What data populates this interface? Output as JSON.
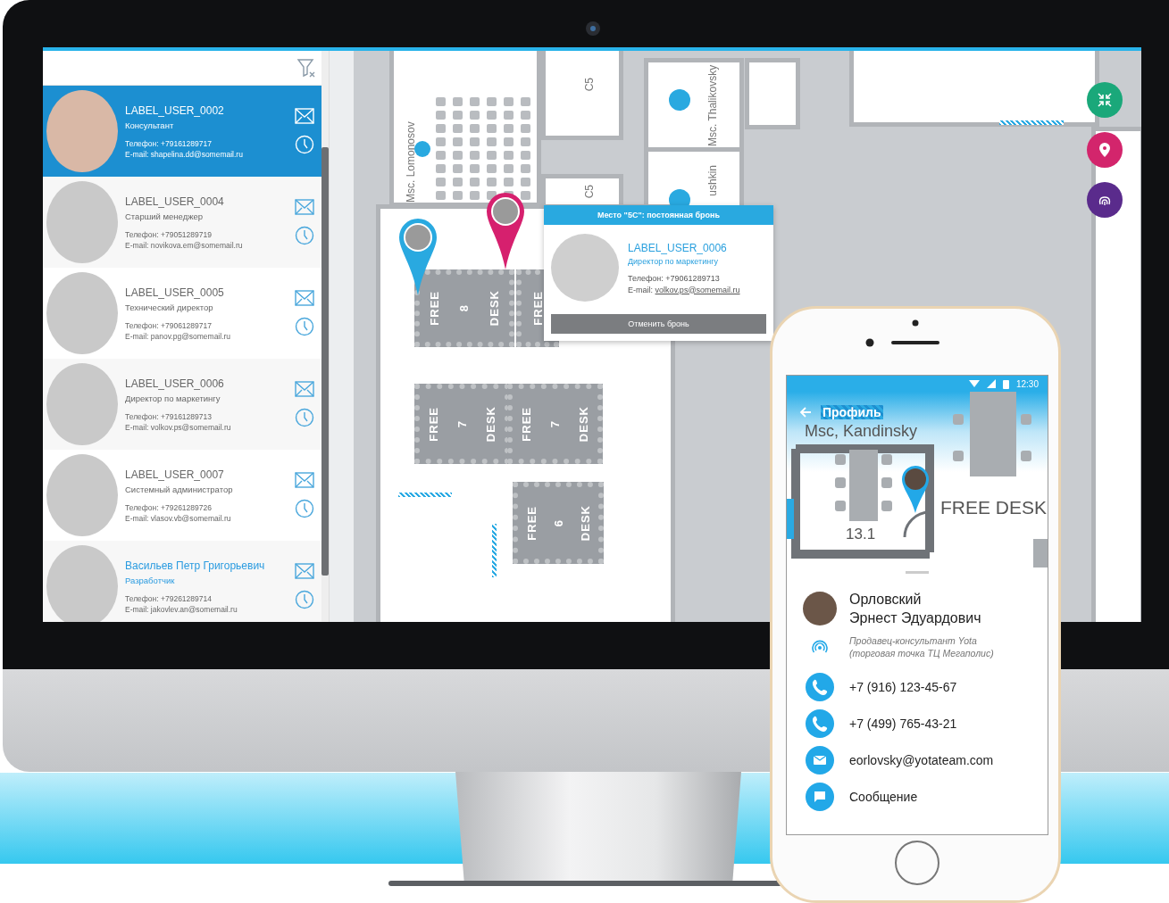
{
  "contacts": [
    {
      "name": "LABEL_USER_0002",
      "position": "Консультант",
      "phone": "Телефон: +79161289717",
      "email": "E-mail: shapelina.dd@somemail.ru",
      "selected": true,
      "highlighted": false
    },
    {
      "name": "LABEL_USER_0004",
      "position": "Старший менеджер",
      "phone": "Телефон: +79051289719",
      "email": "E-mail: novikova.em@somemail.ru",
      "selected": false,
      "highlighted": false
    },
    {
      "name": "LABEL_USER_0005",
      "position": "Технический директор",
      "phone": "Телефон: +79061289717",
      "email": "E-mail: panov.pg@somemail.ru",
      "selected": false,
      "highlighted": false
    },
    {
      "name": "LABEL_USER_0006",
      "position": "Директор по маркетингу",
      "phone": "Телефон: +79161289713",
      "email": "E-mail: volkov.ps@somemail.ru",
      "selected": false,
      "highlighted": false
    },
    {
      "name": "LABEL_USER_0007",
      "position": "Системный администратор",
      "phone": "Телефон: +79261289726",
      "email": "E-mail: vlasov.vb@somemail.ru",
      "selected": false,
      "highlighted": false
    },
    {
      "name": "Васильев Петр Григорьевич",
      "position": "Разработчик",
      "phone": "Телефон: +79261289714",
      "email": "E-mail: jakovlev.an@somemail.ru",
      "selected": false,
      "highlighted": true
    }
  ],
  "map": {
    "room_labels": [
      "Msc. Lomonosov",
      "C5",
      "C5",
      "Msc. Thalikovsky",
      "ushkin"
    ],
    "desks": [
      {
        "labels": [
          "FREE",
          "8",
          "DESK"
        ]
      },
      {
        "labels": [
          "FREE"
        ]
      },
      {
        "labels": [
          "FREE",
          "7",
          "DESK"
        ]
      },
      {
        "labels": [
          "FREE",
          "7",
          "DESK"
        ]
      },
      {
        "labels": [
          "FREE",
          "6",
          "DESK"
        ]
      }
    ],
    "pins": [
      {
        "color": "#29a9e0"
      },
      {
        "color": "#d6206e"
      }
    ],
    "popup": {
      "header": "Место \"5С\": постоянная бронь",
      "name": "LABEL_USER_0006",
      "position": "Директор по маркетингу",
      "phone": "Телефон: +79061289713",
      "email_label": "E-mail:",
      "email": "volkov.ps@somemail.ru",
      "button": "Отменить бронь"
    },
    "actions": [
      {
        "kind": "collapse",
        "color": "#1aa87a"
      },
      {
        "kind": "location",
        "color": "#d3256c"
      },
      {
        "kind": "fingerprint",
        "color": "#5a2b8c"
      }
    ]
  },
  "phone": {
    "time": "12:30",
    "title": "Профиль",
    "map_labels": [
      "Msc, Kandinsky",
      "13.1",
      "FREE DESK"
    ],
    "person": {
      "surname": "Орловский",
      "given_names": "Эрнест Эдуардович",
      "position_lines": [
        "Продавец-консультант Yota",
        "(торговая точка ТЦ Мегаполис)"
      ]
    },
    "contacts": [
      {
        "kind": "phone",
        "text": "+7 (916) 123-45-67"
      },
      {
        "kind": "phone",
        "text": "+7 (499) 765-43-21"
      },
      {
        "kind": "email",
        "text": "eorlovsky@yotateam.com"
      },
      {
        "kind": "message",
        "text": "Сообщение"
      }
    ]
  }
}
